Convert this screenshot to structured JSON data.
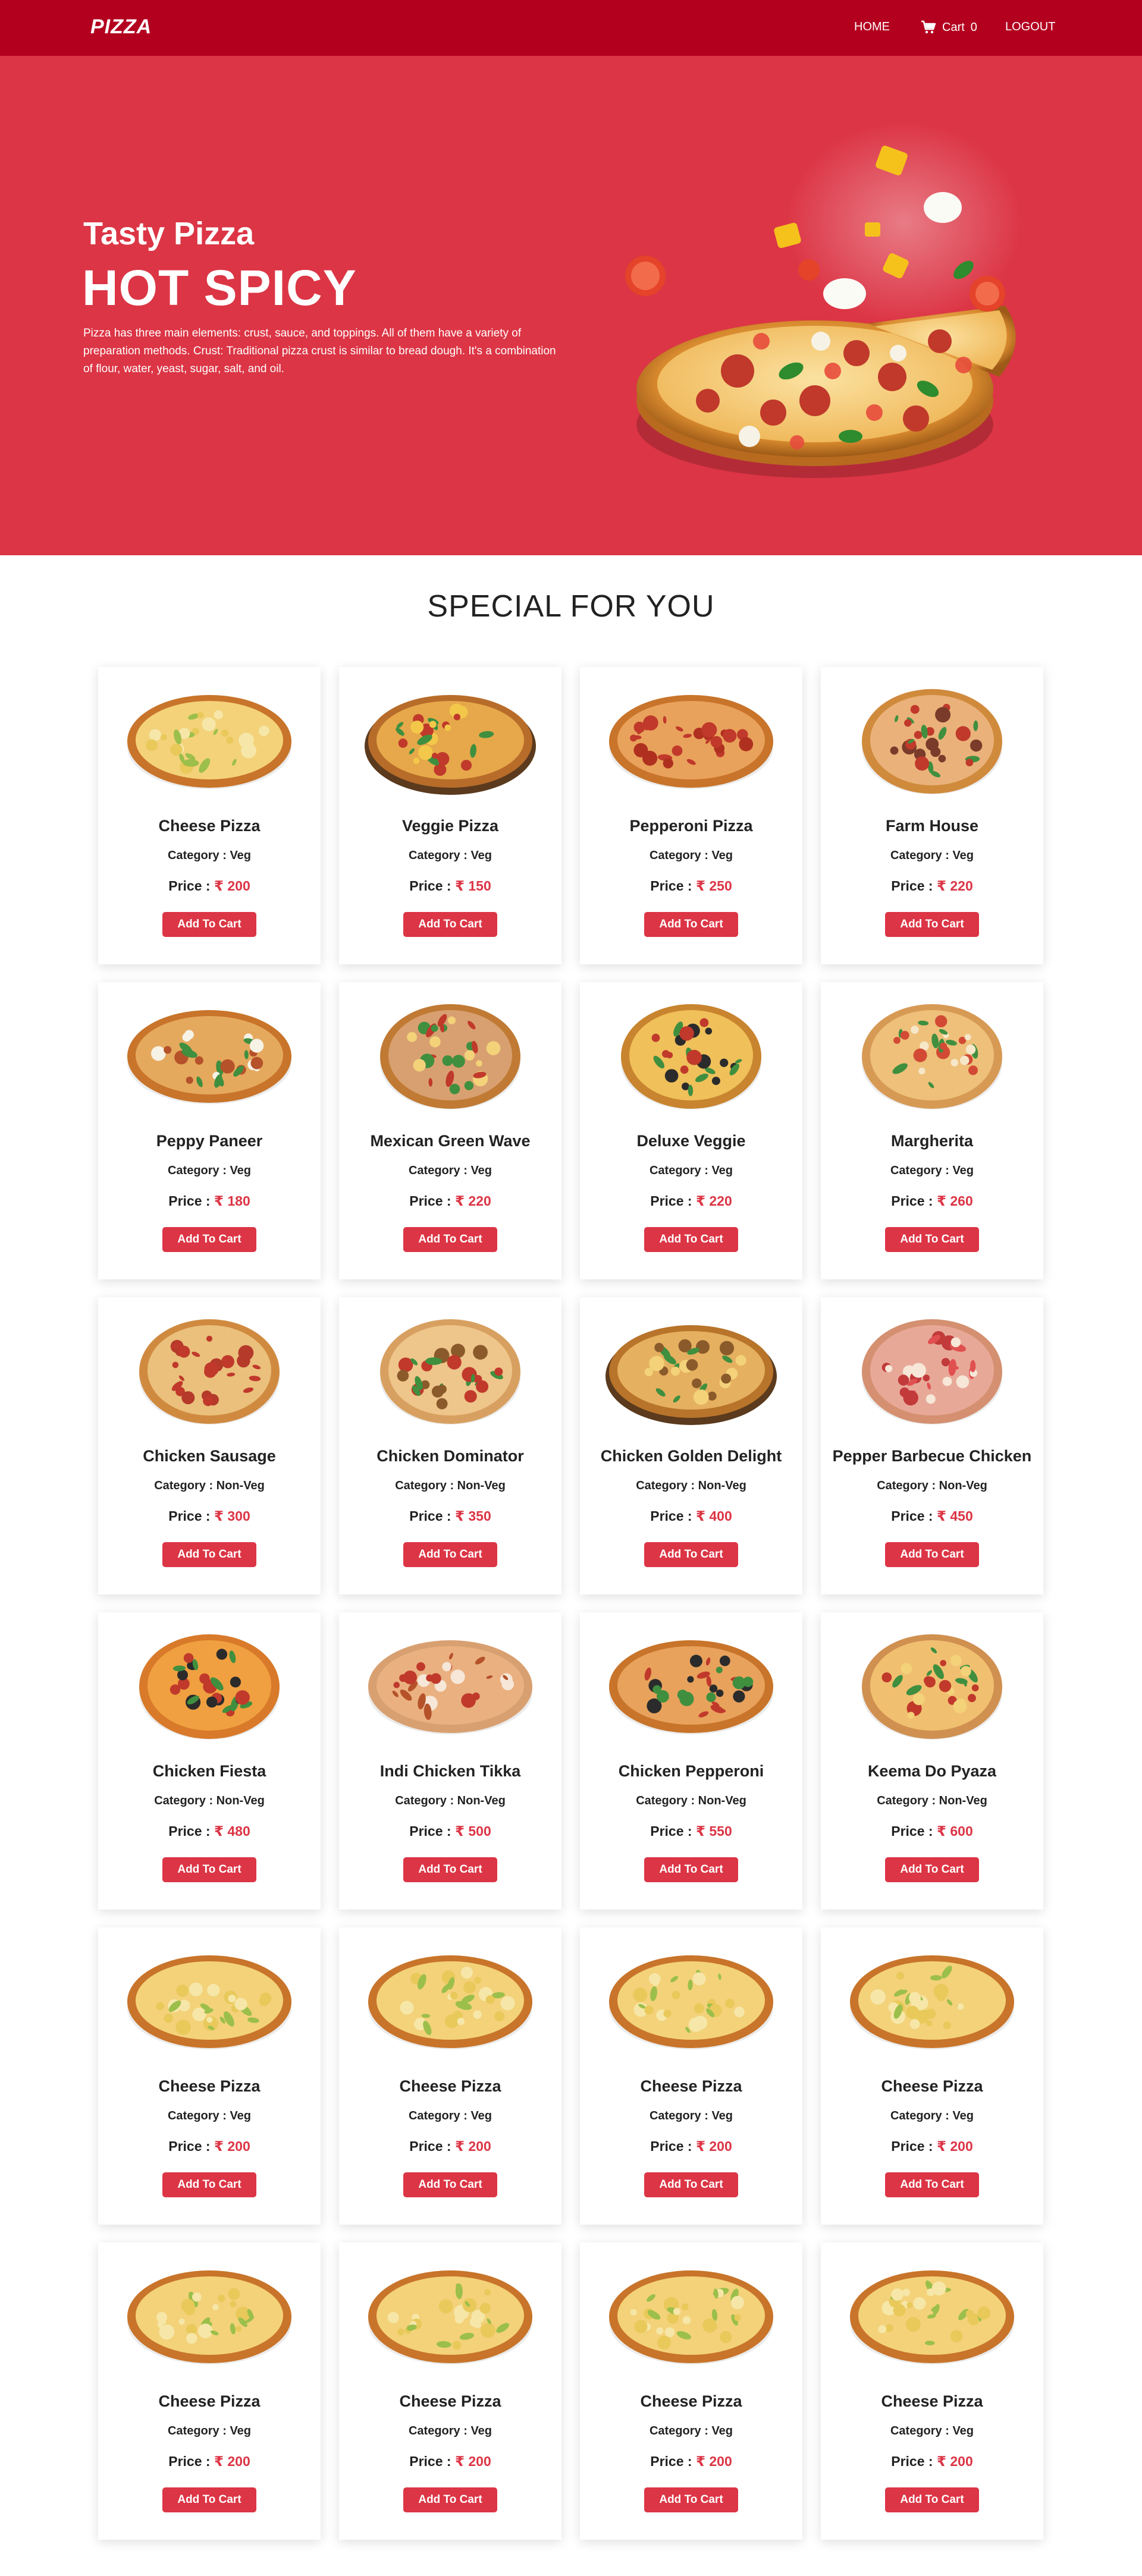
{
  "nav": {
    "brand": "PIZZA",
    "home": "HOME",
    "cart_label": "Cart",
    "cart_count": "0",
    "logout": "LOGOUT"
  },
  "hero": {
    "subtitle": "Tasty Pizza",
    "title": "HOT SPICY",
    "description": "Pizza has three main elements: crust, sauce, and toppings. All of them have a variety of preparation methods. Crust: Traditional pizza crust is similar to bread dough. It's a combination of flour, water, yeast, sugar, salt, and oil."
  },
  "section": {
    "title": "SPECIAL FOR YOU"
  },
  "labels": {
    "category_prefix": "Category : ",
    "price_prefix": "Price : ",
    "currency": "₹",
    "add_to_cart": "Add To Cart"
  },
  "colors": {
    "brand_dark": "#b3001f",
    "accent": "#dc3545"
  },
  "products": [
    {
      "name": "Cheese Pizza",
      "category": "Veg",
      "price": "200",
      "style": "cheese"
    },
    {
      "name": "Veggie Pizza",
      "category": "Veg",
      "price": "150",
      "style": "veggie"
    },
    {
      "name": "Pepperoni Pizza",
      "category": "Veg",
      "price": "250",
      "style": "pepperoni"
    },
    {
      "name": "Farm House",
      "category": "Veg",
      "price": "220",
      "style": "farm"
    },
    {
      "name": "Peppy Paneer",
      "category": "Veg",
      "price": "180",
      "style": "paneer"
    },
    {
      "name": "Mexican Green Wave",
      "category": "Veg",
      "price": "220",
      "style": "mexican"
    },
    {
      "name": "Deluxe Veggie",
      "category": "Veg",
      "price": "220",
      "style": "deluxe"
    },
    {
      "name": "Margherita",
      "category": "Veg",
      "price": "260",
      "style": "margherita"
    },
    {
      "name": "Chicken Sausage",
      "category": "Non-Veg",
      "price": "300",
      "style": "sausage"
    },
    {
      "name": "Chicken Dominator",
      "category": "Non-Veg",
      "price": "350",
      "style": "dominator"
    },
    {
      "name": "Chicken Golden Delight",
      "category": "Non-Veg",
      "price": "400",
      "style": "golden"
    },
    {
      "name": "Pepper Barbecue Chicken",
      "category": "Non-Veg",
      "price": "450",
      "style": "bbq"
    },
    {
      "name": "Chicken Fiesta",
      "category": "Non-Veg",
      "price": "480",
      "style": "fiesta"
    },
    {
      "name": "Indi Chicken Tikka",
      "category": "Non-Veg",
      "price": "500",
      "style": "tikka"
    },
    {
      "name": "Chicken Pepperoni",
      "category": "Non-Veg",
      "price": "550",
      "style": "chpepperoni"
    },
    {
      "name": "Keema Do Pyaza",
      "category": "Non-Veg",
      "price": "600",
      "style": "keema"
    },
    {
      "name": "Cheese Pizza",
      "category": "Veg",
      "price": "200",
      "style": "cheese"
    },
    {
      "name": "Cheese Pizza",
      "category": "Veg",
      "price": "200",
      "style": "cheese"
    },
    {
      "name": "Cheese Pizza",
      "category": "Veg",
      "price": "200",
      "style": "cheese"
    },
    {
      "name": "Cheese Pizza",
      "category": "Veg",
      "price": "200",
      "style": "cheese"
    },
    {
      "name": "Cheese Pizza",
      "category": "Veg",
      "price": "200",
      "style": "cheese"
    },
    {
      "name": "Cheese Pizza",
      "category": "Veg",
      "price": "200",
      "style": "cheese"
    },
    {
      "name": "Cheese Pizza",
      "category": "Veg",
      "price": "200",
      "style": "cheese"
    },
    {
      "name": "Cheese Pizza",
      "category": "Veg",
      "price": "200",
      "style": "cheese"
    }
  ]
}
